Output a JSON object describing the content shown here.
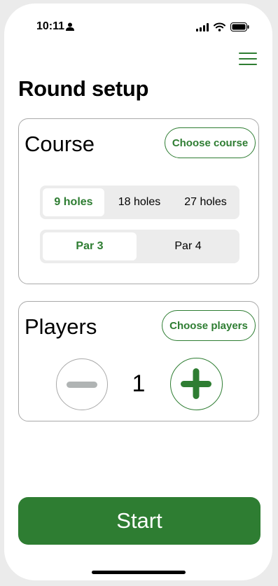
{
  "status_bar": {
    "time": "10:11",
    "icons": [
      "person-icon",
      "signal-icon",
      "wifi-icon",
      "battery-icon"
    ]
  },
  "header": {
    "menu_icon": "hamburger-menu-icon",
    "title": "Round setup"
  },
  "course": {
    "title": "Course",
    "choose_label": "Choose course",
    "holes_options": [
      "9 holes",
      "18 holes",
      "27 holes"
    ],
    "holes_selected": "9 holes",
    "par_options": [
      "Par 3",
      "Par 4"
    ],
    "par_selected": "Par 3"
  },
  "players": {
    "title": "Players",
    "choose_label": "Choose players",
    "count": "1",
    "decrement_icon": "minus-icon",
    "increment_icon": "plus-icon"
  },
  "start_label": "Start",
  "colors": {
    "accent": "#2e7d32",
    "border": "#a9a9a9",
    "segment_bg": "#ececec",
    "disabled": "#b0b4b4"
  }
}
